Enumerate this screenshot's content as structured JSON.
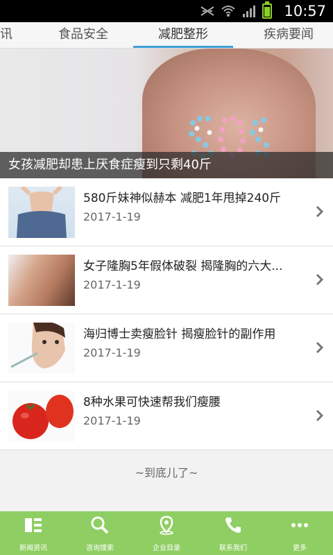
{
  "status_bar": {
    "time": "10:57"
  },
  "tabs": [
    {
      "label": "讯"
    },
    {
      "label": "食品安全"
    },
    {
      "label": "减肥整形"
    },
    {
      "label": "疾病要闻"
    }
  ],
  "active_tab": "减肥整形",
  "hero": {
    "caption": "女孩减肥却患上厌食症瘦到只剩40斤"
  },
  "news": [
    {
      "title": "580斤妹神似赫本 减肥1年甩掉240斤",
      "date": "2017-1-19",
      "thumb_icon": "weight-loss-photo"
    },
    {
      "title": "女子隆胸5年假体破裂 揭隆胸的六大...",
      "date": "2017-1-19",
      "thumb_icon": "back-photo"
    },
    {
      "title": "海归博士卖瘦脸针 揭瘦脸针的副作用",
      "date": "2017-1-19",
      "thumb_icon": "injection-photo"
    },
    {
      "title": "8种水果可快速帮我们瘦腰",
      "date": "2017-1-19",
      "thumb_icon": "tomato-photo"
    }
  ],
  "footer_note": "~到底儿了~",
  "bottom_nav": [
    {
      "label": "新闻资讯",
      "icon": "list-icon"
    },
    {
      "label": "咨询搜索",
      "icon": "search-icon"
    },
    {
      "label": "企业目录",
      "icon": "location-icon"
    },
    {
      "label": "联系我们",
      "icon": "phone-icon"
    },
    {
      "label": "更多",
      "icon": "more-icon"
    }
  ],
  "colors": {
    "accent": "#3ea0db",
    "nav_bg": "#8fce63"
  }
}
